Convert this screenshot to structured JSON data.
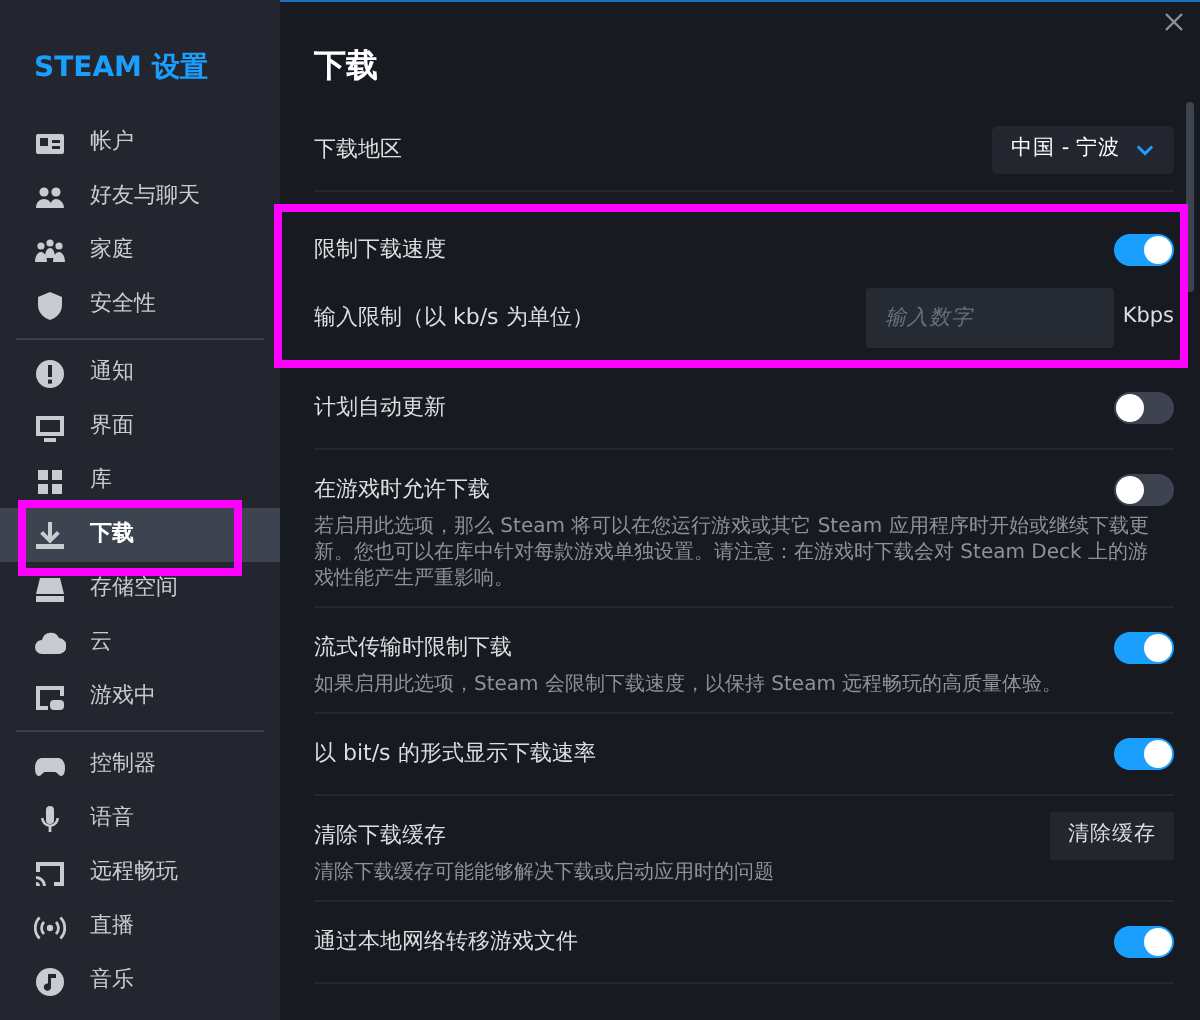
{
  "sidebar": {
    "title": "STEAM 设置",
    "groups": [
      [
        {
          "label": "帐户",
          "selected": false,
          "highlighted": false
        },
        {
          "label": "好友与聊天",
          "selected": false,
          "highlighted": false
        },
        {
          "label": "家庭",
          "selected": false,
          "highlighted": false
        },
        {
          "label": "安全性",
          "selected": false,
          "highlighted": false
        }
      ],
      [
        {
          "label": "通知",
          "selected": false,
          "highlighted": false
        },
        {
          "label": "界面",
          "selected": false,
          "highlighted": false
        },
        {
          "label": "库",
          "selected": false,
          "highlighted": false
        },
        {
          "label": "下载",
          "selected": true,
          "highlighted": true
        },
        {
          "label": "存储空间",
          "selected": false,
          "highlighted": false
        },
        {
          "label": "云",
          "selected": false,
          "highlighted": false
        },
        {
          "label": "游戏中",
          "selected": false,
          "highlighted": false
        }
      ],
      [
        {
          "label": "控制器",
          "selected": false,
          "highlighted": false
        },
        {
          "label": "语音",
          "selected": false,
          "highlighted": false
        },
        {
          "label": "远程畅玩",
          "selected": false,
          "highlighted": false
        },
        {
          "label": "直播",
          "selected": false,
          "highlighted": false
        },
        {
          "label": "音乐",
          "selected": false,
          "highlighted": false
        }
      ]
    ]
  },
  "main": {
    "title": "下载",
    "sections": [
      {
        "highlighted": false,
        "rows": [
          {
            "kind": "dropdown",
            "label": "下载地区",
            "value": "中国 - 宁波"
          }
        ]
      },
      {
        "highlighted": true,
        "rows": [
          {
            "kind": "toggle",
            "label": "限制下载速度",
            "on": true
          },
          {
            "kind": "number_input",
            "label": "输入限制（以 kb/s 为单位）",
            "placeholder": "输入数字",
            "unit": "Kbps"
          }
        ]
      },
      {
        "highlighted": false,
        "rows": [
          {
            "kind": "toggle",
            "label": "计划自动更新",
            "on": false
          }
        ]
      },
      {
        "highlighted": false,
        "rows": [
          {
            "kind": "toggle",
            "label": "在游戏时允许下载",
            "on": false,
            "description": "若启用此选项，那么 Steam 将可以在您运行游戏或其它 Steam 应用程序时开始或继续下载更新。您也可以在库中针对每款游戏单独设置。请注意：在游戏时下载会对 Steam Deck 上的游戏性能产生严重影响。"
          }
        ]
      },
      {
        "highlighted": false,
        "rows": [
          {
            "kind": "toggle",
            "label": "流式传输时限制下载",
            "on": true,
            "description": "如果启用此选项，Steam 会限制下载速度，以保持 Steam 远程畅玩的高质量体验。"
          }
        ]
      },
      {
        "highlighted": false,
        "rows": [
          {
            "kind": "toggle",
            "label": "以 bit/s 的形式显示下载速率",
            "on": true
          }
        ]
      },
      {
        "highlighted": false,
        "rows": [
          {
            "kind": "button",
            "label": "清除下载缓存",
            "button": "清除缓存",
            "description": "清除下载缓存可能能够解决下载或启动应用时的问题"
          }
        ]
      },
      {
        "highlighted": false,
        "rows": [
          {
            "kind": "toggle",
            "label": "通过本地网络转移游戏文件",
            "on": true
          }
        ]
      }
    ]
  }
}
